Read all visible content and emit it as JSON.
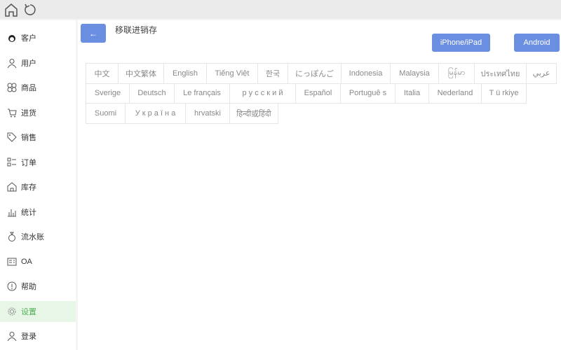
{
  "topbar": {
    "icons": [
      "home-icon",
      "refresh-icon"
    ]
  },
  "sidebar": {
    "items": [
      {
        "label": "客户",
        "icon": "customer-icon"
      },
      {
        "label": "用户",
        "icon": "user-icon"
      },
      {
        "label": "商品",
        "icon": "goods-icon"
      },
      {
        "label": "进货",
        "icon": "cart-icon"
      },
      {
        "label": "销售",
        "icon": "tag-icon"
      },
      {
        "label": "订单",
        "icon": "list-icon"
      },
      {
        "label": "库存",
        "icon": "warehouse-icon"
      },
      {
        "label": "统计",
        "icon": "chart-icon"
      },
      {
        "label": "流水账",
        "icon": "moneybag-icon"
      },
      {
        "label": "OA",
        "icon": "id-card-icon"
      },
      {
        "label": "帮助",
        "icon": "info-icon"
      },
      {
        "label": "设置",
        "icon": "gear-icon",
        "active": true
      },
      {
        "label": "登录",
        "icon": "login-user-icon"
      }
    ],
    "active_color": "#4caf50"
  },
  "main": {
    "back_label": "←",
    "title": "移联进销存",
    "iphone_label": "iPhone/iPad",
    "android_label": "Android",
    "accent": "#6b8fe0"
  },
  "languages": [
    [
      "中文",
      "中文繁体",
      "English",
      "Tiếng Việt",
      "한국",
      "にっぽんご",
      "Indonesia",
      "Malaysia",
      "မြန်မာ",
      "ประเทศไทย",
      "عربي"
    ],
    [
      "Sverige",
      "Deutsch",
      "Le français",
      "р у с с к и й",
      "Español",
      "Portuguê s",
      "Italia",
      "Nederland",
      "T ü rkiye"
    ],
    [
      "Suomi",
      "У к р а ї н а",
      "hrvatski",
      "हिन्दी或हिंदी"
    ]
  ]
}
